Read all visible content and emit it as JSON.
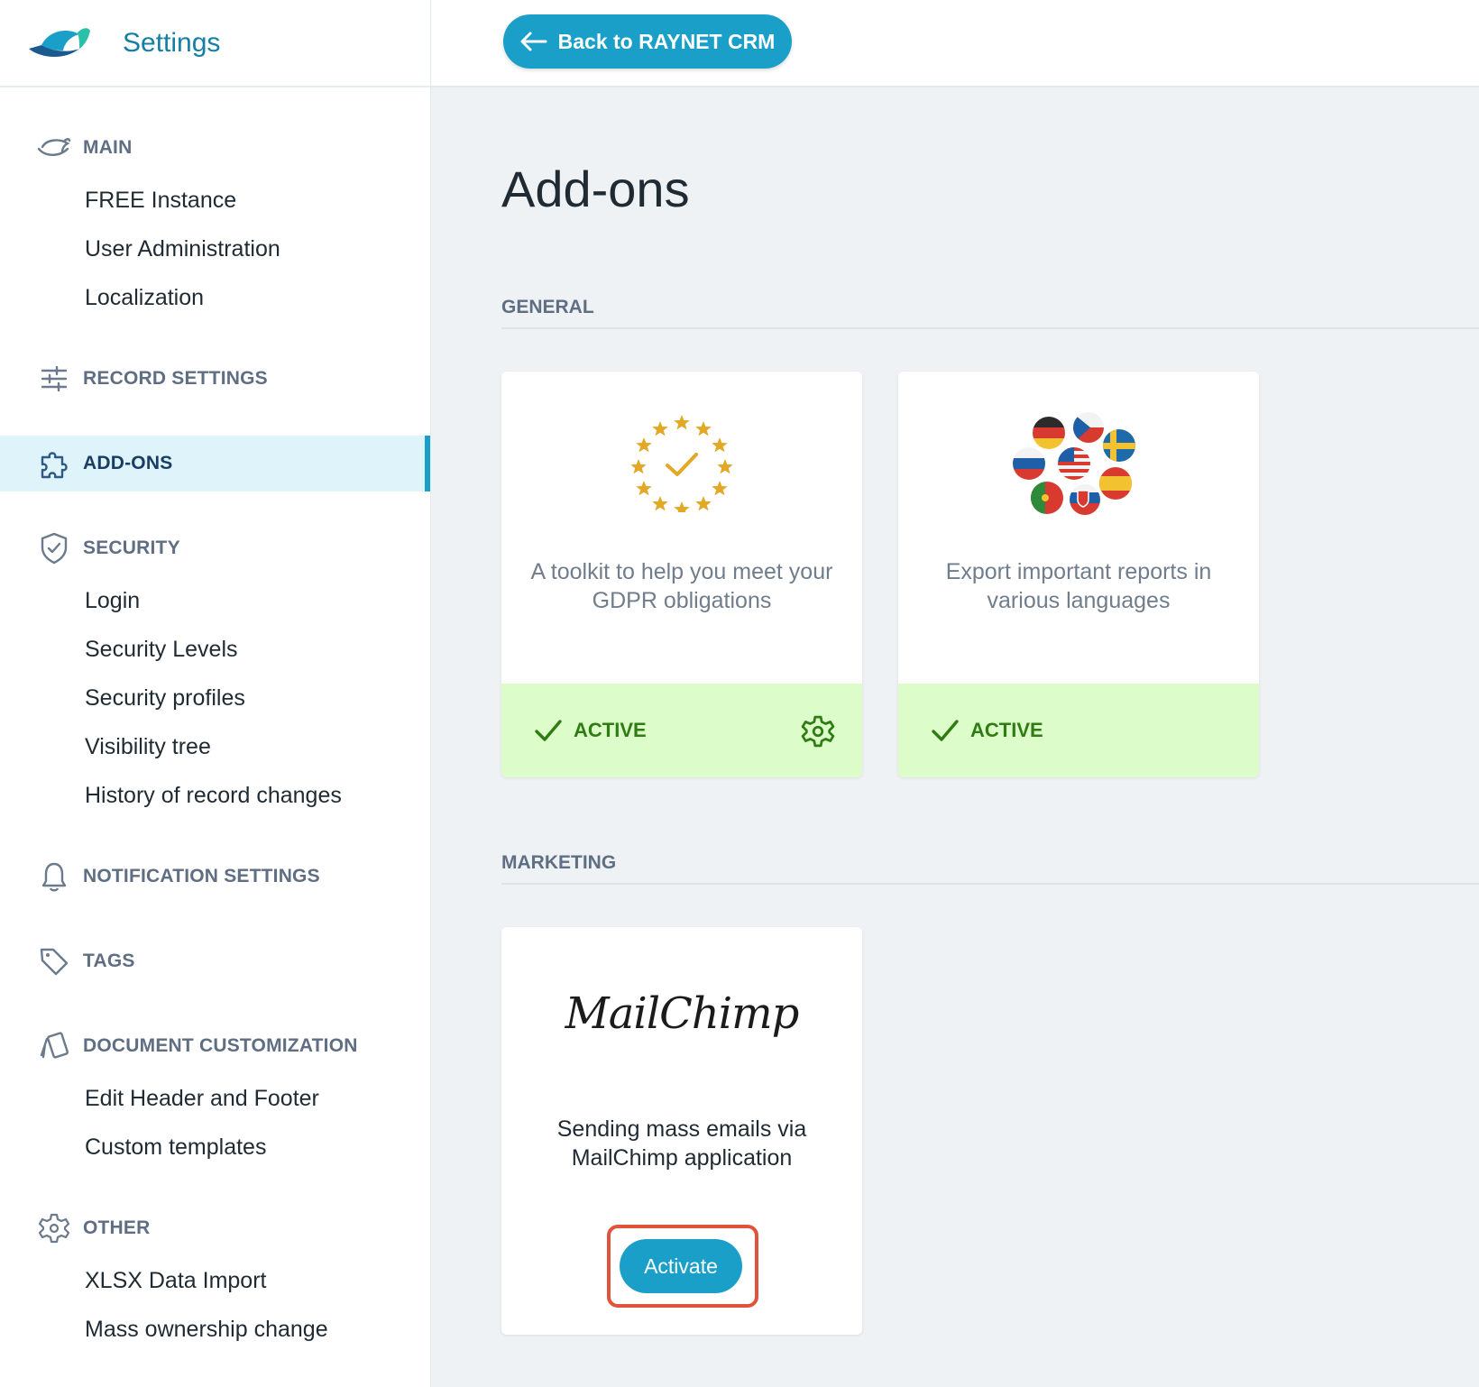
{
  "app": {
    "title": "Settings"
  },
  "topbar": {
    "back_label": "Back to RAYNET CRM"
  },
  "sidebar": {
    "sections": [
      {
        "id": "main",
        "title": "MAIN",
        "icon": "fish-icon",
        "items": [
          "FREE Instance",
          "User Administration",
          "Localization"
        ]
      },
      {
        "id": "record",
        "title": "RECORD SETTINGS",
        "icon": "sliders-icon",
        "items": []
      },
      {
        "id": "addons",
        "title": "ADD-ONS",
        "icon": "puzzle-icon",
        "items": [],
        "active": true
      },
      {
        "id": "security",
        "title": "SECURITY",
        "icon": "shield-icon",
        "items": [
          "Login",
          "Security Levels",
          "Security profiles",
          "Visibility tree",
          "History of record changes"
        ]
      },
      {
        "id": "notifications",
        "title": "NOTIFICATION SETTINGS",
        "icon": "bell-icon",
        "items": []
      },
      {
        "id": "tags",
        "title": "TAGS",
        "icon": "tag-icon",
        "items": []
      },
      {
        "id": "documents",
        "title": "DOCUMENT CUSTOMIZATION",
        "icon": "documents-icon",
        "items": [
          "Edit Header and Footer",
          "Custom templates"
        ]
      },
      {
        "id": "other",
        "title": "OTHER",
        "icon": "gear-icon",
        "items": [
          "XLSX Data Import",
          "Mass ownership change"
        ]
      }
    ]
  },
  "main": {
    "title": "Add-ons",
    "groups": [
      {
        "label": "GENERAL",
        "cards": [
          {
            "icon": "eu-stars-icon",
            "description": "A toolkit to help you meet your GDPR obligations",
            "status": "ACTIVE",
            "has_settings": true
          },
          {
            "icon": "flags-icon",
            "description": "Export important reports in various languages",
            "status": "ACTIVE",
            "has_settings": false
          }
        ]
      },
      {
        "label": "MARKETING",
        "cards": [
          {
            "logo_text": "MailChimp",
            "description": "Sending mass emails via MailChimp application",
            "action_label": "Activate"
          }
        ]
      }
    ]
  },
  "colors": {
    "accent": "#1a9fc9",
    "active_bg": "#dcfcc9",
    "active_text": "#2f7d12",
    "highlight": "#e0533c"
  }
}
